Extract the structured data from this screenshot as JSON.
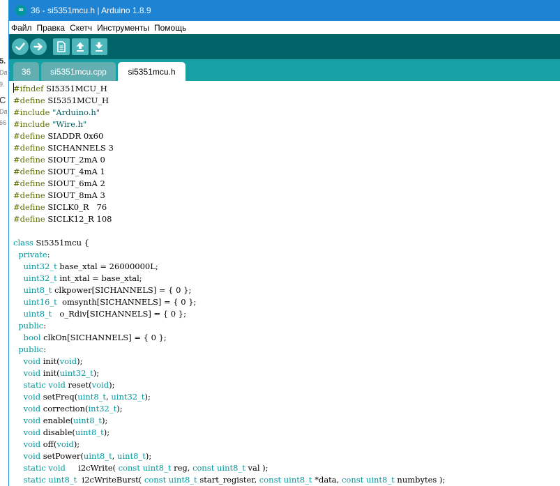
{
  "background_window": {
    "fragments": [
      "5.",
      "Da",
      "9.",
      "C",
      "Da",
      "66"
    ]
  },
  "window": {
    "title": "36 - si5351mcu.h | Arduino 1.8.9",
    "app_icon_glyph": "∞"
  },
  "menu": {
    "items": [
      "Файл",
      "Правка",
      "Скетч",
      "Инструменты",
      "Помощь"
    ]
  },
  "toolbar": {
    "buttons": [
      {
        "icon": "verify-icon"
      },
      {
        "icon": "upload-icon"
      },
      {
        "icon": "new-icon"
      },
      {
        "icon": "open-icon"
      },
      {
        "icon": "save-icon"
      }
    ],
    "colors": {
      "bar": "#006468",
      "button": "#4db7bb"
    }
  },
  "tabs": [
    {
      "label": "36",
      "active": false
    },
    {
      "label": "si5351mcu.cpp",
      "active": false
    },
    {
      "label": "si5351mcu.h",
      "active": true
    }
  ],
  "editor": {
    "lines": [
      "#ifndef SI5351MCU_H",
      "#define SI5351MCU_H",
      "#include \"Arduino.h\"",
      "#include \"Wire.h\"",
      "#define SIADDR 0x60",
      "#define SICHANNELS 3",
      "#define SIOUT_2mA 0",
      "#define SIOUT_4mA 1",
      "#define SIOUT_6mA 2",
      "#define SIOUT_8mA 3",
      "#define SICLK0_R   76",
      "#define SICLK12_R 108",
      "",
      "class Si5351mcu {",
      "  private:",
      "    uint32_t base_xtal = 26000000L;",
      "    uint32_t int_xtal = base_xtal;",
      "    uint8_t clkpower[SICHANNELS] = { 0 };",
      "    uint16_t  omsynth[SICHANNELS] = { 0 };",
      "    uint8_t   o_Rdiv[SICHANNELS] = { 0 };",
      "  public:",
      "    bool clkOn[SICHANNELS] = { 0 };",
      "  public:",
      "    void init(void);",
      "    void init(uint32_t);",
      "    static void reset(void);",
      "    void setFreq(uint8_t, uint32_t);",
      "    void correction(int32_t);",
      "    void enable(uint8_t);",
      "    void disable(uint8_t);",
      "    void off(void);",
      "    void setPower(uint8_t, uint8_t);",
      "    static void     i2cWrite( const uint8_t reg, const uint8_t val );",
      "    static uint8_t  i2cWriteBurst( const uint8_t start_register, const uint8_t *data, const uint8_t numbytes );"
    ],
    "colors": {
      "directive": "#5e6d03",
      "type": "#00979c",
      "string": "#005c5f",
      "text": "#000000"
    }
  }
}
